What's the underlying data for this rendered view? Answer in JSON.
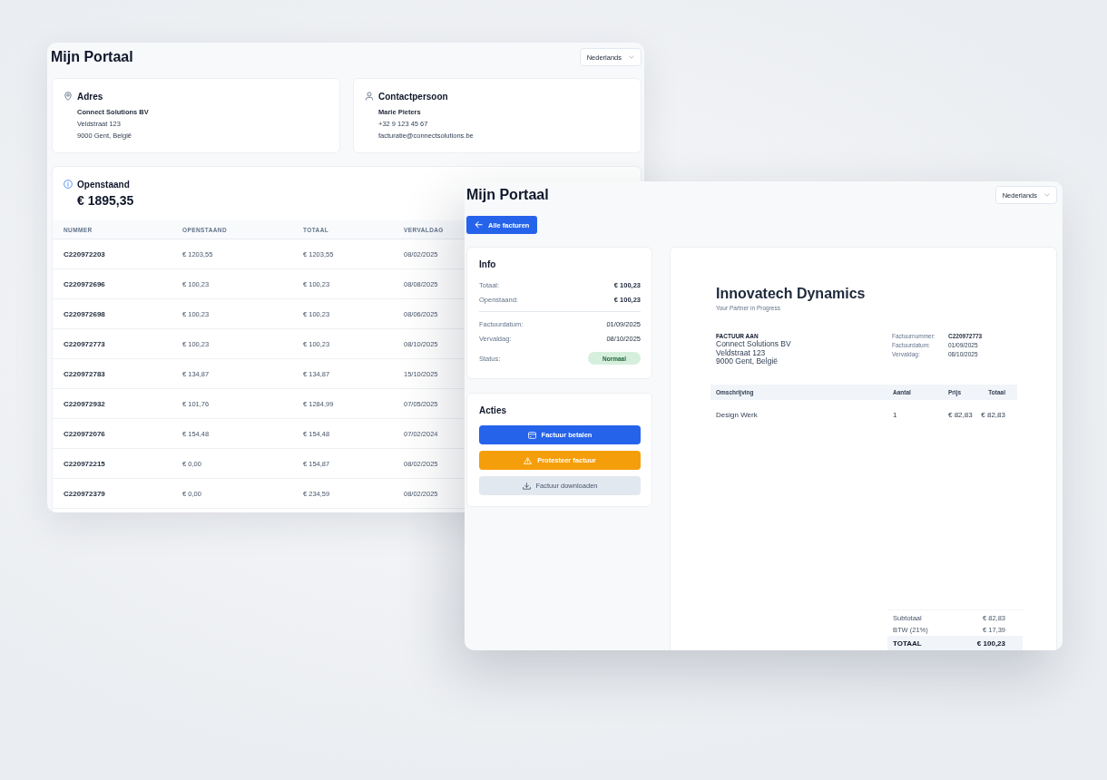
{
  "back_window": {
    "title": "Mijn Portaal",
    "language_select": {
      "value": "Nederlands"
    },
    "address_card": {
      "title": "Adres",
      "name": "Connect Solutions BV",
      "lines": [
        "Veldstraat 123",
        "9000 Gent, België"
      ]
    },
    "contact_card": {
      "title": "Contactpersoon",
      "name": "Marie Pieters",
      "lines": [
        "+32 9 123 45 67",
        "facturatie@connectsolutions.be"
      ]
    },
    "outstanding": {
      "title": "Openstaand",
      "amount": "€ 1895,35",
      "table": {
        "columns": [
          "NUMMER",
          "OPENSTAAND",
          "TOTAAL",
          "VERVALDAG"
        ],
        "rows": [
          [
            "C220972203",
            "€ 1203,55",
            "€ 1203,55",
            "08/02/2025"
          ],
          [
            "C220972696",
            "€ 100,23",
            "€ 100,23",
            "08/08/2025"
          ],
          [
            "C220972698",
            "€ 100,23",
            "€ 100,23",
            "08/06/2025"
          ],
          [
            "C220972773",
            "€ 100,23",
            "€ 100,23",
            "08/10/2025"
          ],
          [
            "C220972783",
            "€ 134,87",
            "€ 134,87",
            "15/10/2025"
          ],
          [
            "C220972932",
            "€ 101,76",
            "€ 1284,99",
            "07/05/2025"
          ],
          [
            "C220972076",
            "€ 154,48",
            "€ 154,48",
            "07/02/2024"
          ],
          [
            "C220972215",
            "€ 0,00",
            "€ 154,87",
            "08/02/2025"
          ],
          [
            "C220972379",
            "€ 0,00",
            "€ 234,59",
            "08/02/2025"
          ]
        ]
      }
    }
  },
  "front_window": {
    "title": "Mijn Portaal",
    "language_select": {
      "value": "Nederlands"
    },
    "back_button": {
      "label": "Alle facturen"
    },
    "info_card": {
      "title": "Info",
      "rows": [
        {
          "label": "Totaal:",
          "value": "€ 100,23",
          "kind": "amount"
        },
        {
          "label": "Openstaand:",
          "value": "€ 100,23",
          "kind": "amount"
        },
        {
          "label": "Factuurdatum:",
          "value": "01/09/2025",
          "kind": "date"
        },
        {
          "label": "Vervaldag:",
          "value": "08/10/2025",
          "kind": "date"
        },
        {
          "label": "Status:",
          "value": "Normaal",
          "kind": "badge"
        }
      ]
    },
    "actions_card": {
      "title": "Acties",
      "buttons": [
        {
          "label": "Factuur betalen",
          "kind": "primary"
        },
        {
          "label": "Protesteer factuur",
          "kind": "warning"
        },
        {
          "label": "Factuur downloaden",
          "kind": "secondary"
        }
      ]
    },
    "invoice": {
      "company": "Innovatech Dynamics",
      "tagline": "Your Partner in Progress",
      "bill_to": {
        "heading": "FACTUUR AAN",
        "lines": [
          "Connect Solutions BV",
          "Veldstraat 123",
          "9000 Gent, België"
        ]
      },
      "meta": [
        {
          "label": "Factuurnummer:",
          "value": "C220972773"
        },
        {
          "label": "Factuurdatum:",
          "value": "01/09/2025"
        },
        {
          "label": "Vervaldag:",
          "value": "08/10/2025"
        }
      ],
      "items": {
        "columns": [
          "Omschrijving",
          "Aantal",
          "Prijs",
          "Totaal"
        ],
        "rows": [
          [
            "Design Werk",
            "1",
            "€ 82,83",
            "€ 82,83"
          ]
        ]
      },
      "totals": [
        {
          "label": "Subtotaal",
          "value": "€ 82,83",
          "kind": "line"
        },
        {
          "label": "BTW (21%)",
          "value": "€ 17,39",
          "kind": "line"
        },
        {
          "label": "TOTAAL",
          "value": "€ 100,23",
          "kind": "grand"
        }
      ]
    }
  }
}
